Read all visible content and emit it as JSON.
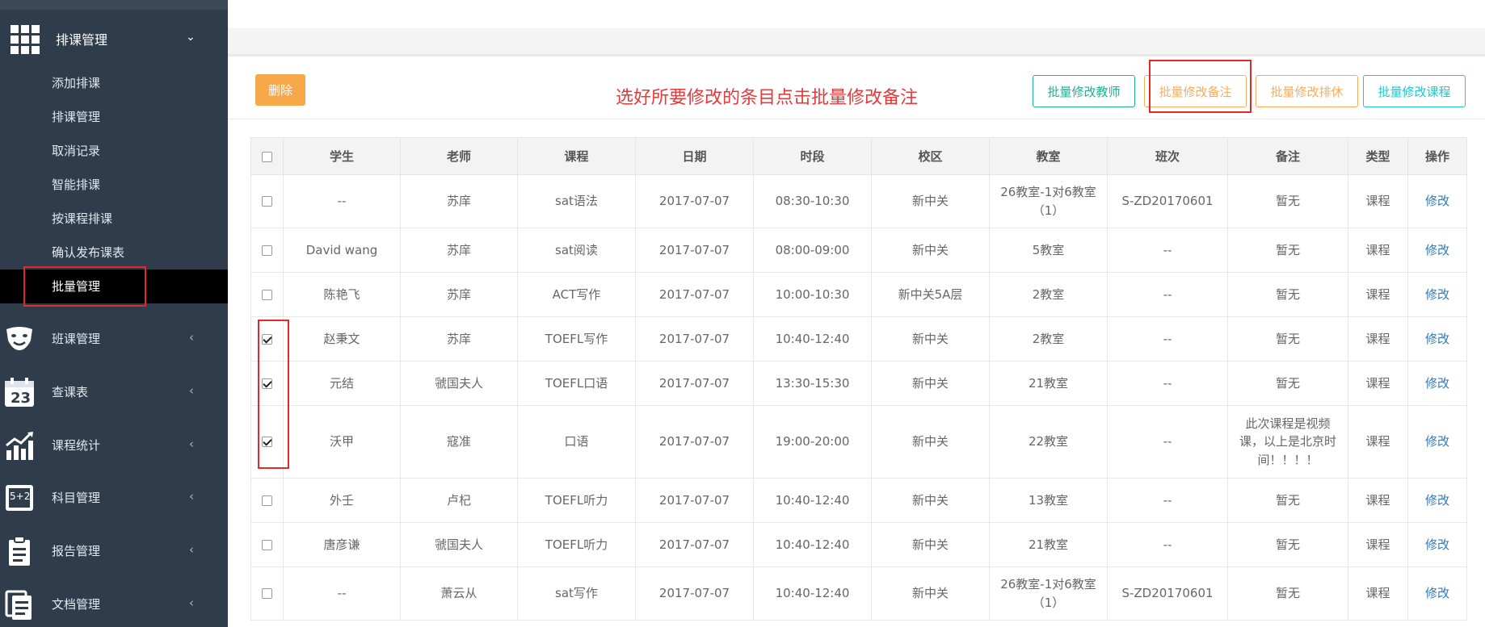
{
  "sidebar": {
    "main_menu": {
      "label": "排课管理",
      "chevron": "⌄",
      "icon": "grid-icon"
    },
    "sub_items": [
      {
        "label": "添加排课",
        "active": false
      },
      {
        "label": "排课管理",
        "active": false
      },
      {
        "label": "取消记录",
        "active": false
      },
      {
        "label": "智能排课",
        "active": false
      },
      {
        "label": "按课程排课",
        "active": false
      },
      {
        "label": "确认发布课表",
        "active": false
      },
      {
        "label": "批量管理",
        "active": true
      }
    ],
    "nav_items": [
      {
        "label": "班课管理",
        "icon": "theater-masks-icon",
        "chevron": "‹"
      },
      {
        "label": "查课表",
        "icon": "calendar-icon",
        "calendar_day": "23",
        "chevron": "‹"
      },
      {
        "label": "课程统计",
        "icon": "bar-chart-icon",
        "chevron": "‹"
      },
      {
        "label": "科目管理",
        "icon": "math-board-icon",
        "board_text": "5+2",
        "chevron": "‹"
      },
      {
        "label": "报告管理",
        "icon": "clipboard-icon",
        "chevron": "‹"
      },
      {
        "label": "文档管理",
        "icon": "documents-icon",
        "chevron": "‹"
      }
    ]
  },
  "toolbar": {
    "delete_label": "删除",
    "hint": "选好所要修改的条目点击批量修改备注",
    "btn_teacher": "批量修改教师",
    "btn_remark": "批量修改备注",
    "btn_break": "批量修改排休",
    "btn_course": "批量修改课程"
  },
  "colors": {
    "sidebar_bg": "#2e3c4c",
    "highlight": "#e02a2a",
    "delete_btn": "#f6a84a",
    "teal": "#1ab394",
    "orange": "#f8ac59",
    "cyan": "#23c6c8",
    "link": "#337ab7"
  },
  "table": {
    "headers": [
      "学生",
      "老师",
      "课程",
      "日期",
      "时段",
      "校区",
      "教室",
      "班次",
      "备注",
      "类型",
      "操作"
    ],
    "rows": [
      {
        "checked": false,
        "student": "--",
        "teacher": "苏庠",
        "course": "sat语法",
        "date": "2017-07-07",
        "time": "08:30-10:30",
        "campus": "新中关",
        "room": "26教室-1对6教室（1）",
        "cls": "S-ZD20170601",
        "remark": "暂无",
        "type": "课程",
        "op": "修改"
      },
      {
        "checked": false,
        "student": "David wang",
        "teacher": "苏庠",
        "course": "sat阅读",
        "date": "2017-07-07",
        "time": "08:00-09:00",
        "campus": "新中关",
        "room": "5教室",
        "cls": "--",
        "remark": "暂无",
        "type": "课程",
        "op": "修改"
      },
      {
        "checked": false,
        "student": "陈艳飞",
        "teacher": "苏庠",
        "course": "ACT写作",
        "date": "2017-07-07",
        "time": "10:00-10:30",
        "campus": "新中关5A层",
        "room": "2教室",
        "cls": "--",
        "remark": "暂无",
        "type": "课程",
        "op": "修改"
      },
      {
        "checked": true,
        "student": "赵秉文",
        "teacher": "苏庠",
        "course": "TOEFL写作",
        "date": "2017-07-07",
        "time": "10:40-12:40",
        "campus": "新中关",
        "room": "2教室",
        "cls": "--",
        "remark": "暂无",
        "type": "课程",
        "op": "修改"
      },
      {
        "checked": true,
        "student": "元结",
        "teacher": "虢国夫人",
        "course": "TOEFL口语",
        "date": "2017-07-07",
        "time": "13:30-15:30",
        "campus": "新中关",
        "room": "21教室",
        "cls": "--",
        "remark": "暂无",
        "type": "课程",
        "op": "修改"
      },
      {
        "checked": true,
        "student": "沃甲",
        "teacher": "寇准",
        "course": "口语",
        "date": "2017-07-07",
        "time": "19:00-20:00",
        "campus": "新中关",
        "room": "22教室",
        "cls": "--",
        "remark": "此次课程是视频课，以上是北京时间！！！！",
        "type": "课程",
        "op": "修改"
      },
      {
        "checked": false,
        "student": "外壬",
        "teacher": "卢杞",
        "course": "TOEFL听力",
        "date": "2017-07-07",
        "time": "10:40-12:40",
        "campus": "新中关",
        "room": "13教室",
        "cls": "--",
        "remark": "暂无",
        "type": "课程",
        "op": "修改"
      },
      {
        "checked": false,
        "student": "唐彦谦",
        "teacher": "虢国夫人",
        "course": "TOEFL听力",
        "date": "2017-07-07",
        "time": "10:40-12:40",
        "campus": "新中关",
        "room": "21教室",
        "cls": "--",
        "remark": "暂无",
        "type": "课程",
        "op": "修改"
      },
      {
        "checked": false,
        "student": "--",
        "teacher": "萧云从",
        "course": "sat写作",
        "date": "2017-07-07",
        "time": "10:40-12:40",
        "campus": "新中关",
        "room": "26教室-1对6教室（1）",
        "cls": "S-ZD20170601",
        "remark": "暂无",
        "type": "课程",
        "op": "修改"
      }
    ]
  }
}
